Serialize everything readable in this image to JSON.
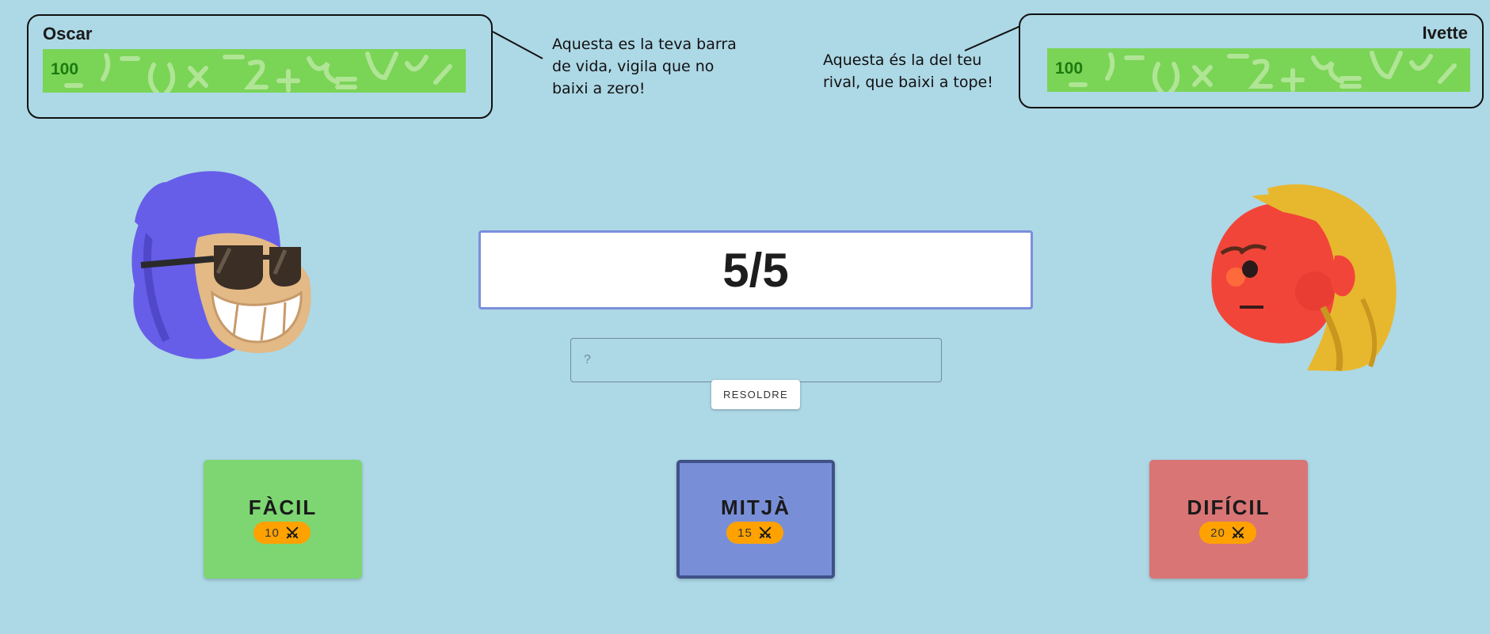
{
  "player": {
    "name": "Oscar",
    "hp": 100
  },
  "rival": {
    "name": "Ivette",
    "hp": 100
  },
  "tips": {
    "player": "Aquesta es la teva barra de vida, vigila que no baixi a zero!",
    "rival": "Aquesta és la del teu rival, que baixi a tope!"
  },
  "problem": {
    "text": "5/5"
  },
  "answer": {
    "placeholder": "?"
  },
  "solve": {
    "label": "RESOLDRE"
  },
  "levels": [
    {
      "label": "FÀCIL",
      "points": "10",
      "icon": "swords-icon"
    },
    {
      "label": "MITJÀ",
      "points": "15",
      "icon": "swords-icon",
      "selected": true
    },
    {
      "label": "DIFÍCIL",
      "points": "20",
      "icon": "swords-icon"
    }
  ],
  "colors": {
    "background": "#add8e6",
    "health_bar": "#7ad456",
    "easy": "#7dd672",
    "medium": "#788fd8",
    "hard": "#d97575",
    "badge": "#ffa200"
  }
}
